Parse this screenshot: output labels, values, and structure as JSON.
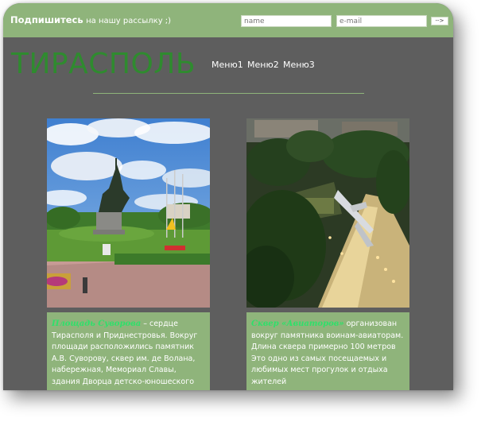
{
  "subscribe": {
    "title": "Подпишитесь",
    "subtitle": "на нашу рассылку ;)",
    "name_placeholder": "name",
    "email_placeholder": "e-mail",
    "submit_label": "-->"
  },
  "header": {
    "logo": "ТИРАСПОЛЬ",
    "menu": [
      "Меню1",
      "Меню2",
      "Меню3"
    ]
  },
  "cards": [
    {
      "title": "Площадь Суворова",
      "text": " – сердце Тирасполя и Приднестровья. Вокруг площади расположились памятник А.В. Суворову, сквер им. де Волана, набережная, Мемориал Славы, здания Дворца детско-юношеского"
    },
    {
      "title": "Сквер «Авиаторов»",
      "text": " организован вокруг памятника воинам-авиаторам. Длина сквера примерно 100 метров Это одно из самых посещаемых и любимых мест прогулок и отдыха жителей"
    }
  ],
  "colors": {
    "accent": "#8fb47b",
    "background": "#5e5e5e",
    "logo": "#2f8b2f",
    "card_title": "#2fe06a"
  }
}
